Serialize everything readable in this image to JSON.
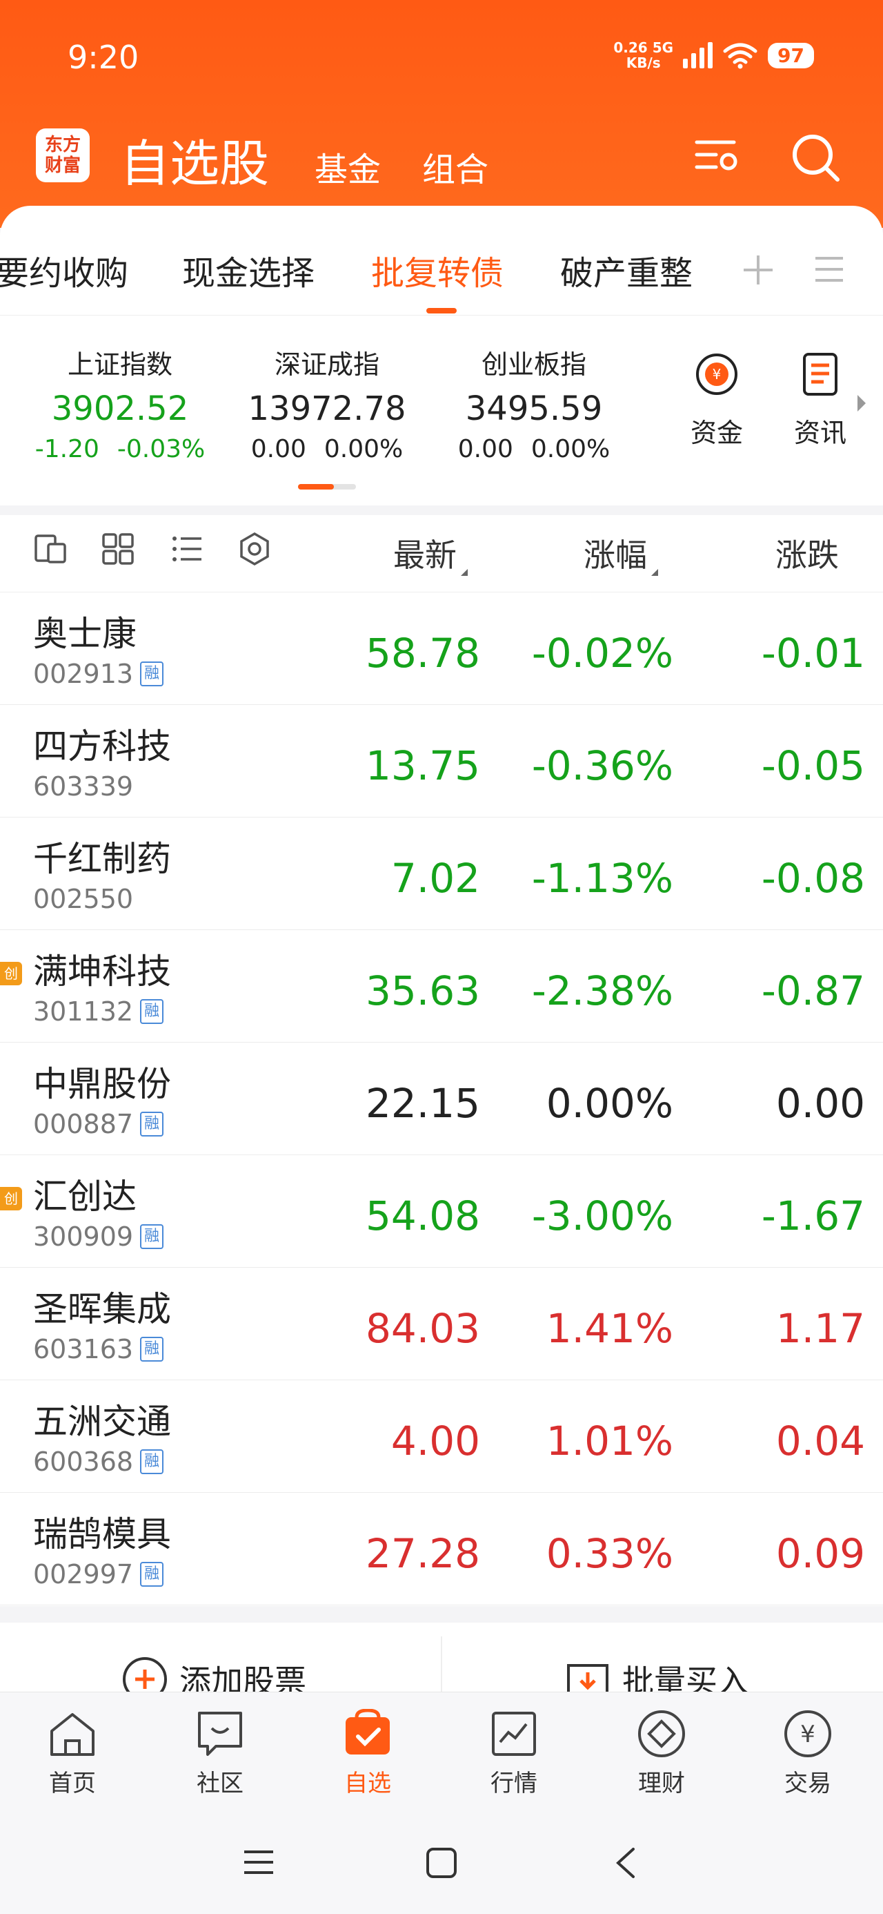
{
  "status_bar": {
    "time": "9:20",
    "net_speed_value": "0.26",
    "net_speed_unit": "KB/s",
    "network": "5G",
    "battery": "97"
  },
  "header": {
    "logo_line1": "东方",
    "logo_line2": "财富",
    "title": "自选股",
    "tabs": [
      "基金",
      "组合"
    ],
    "icons": [
      "settings-list-icon",
      "search-icon"
    ],
    "accent_color": "#ff5a14"
  },
  "group_tabs": {
    "items": [
      "要约收购",
      "现金选择",
      "批复转债",
      "破产重整"
    ],
    "active": "批复转债"
  },
  "indices": [
    {
      "name": "上证指数",
      "value": "3902.52",
      "change": "-1.20",
      "pct": "-0.03%",
      "trend": "down"
    },
    {
      "name": "深证成指",
      "value": "13972.78",
      "change": "0.00",
      "pct": "0.00%",
      "trend": "flat"
    },
    {
      "name": "创业板指",
      "value": "3495.59",
      "change": "0.00",
      "pct": "0.00%",
      "trend": "flat"
    }
  ],
  "quick_links": [
    {
      "label": "资金",
      "icon": "fund-flow-icon"
    },
    {
      "label": "资讯",
      "icon": "news-icon"
    }
  ],
  "columns": {
    "latest": "最新",
    "pct": "涨幅",
    "change": "涨跌"
  },
  "stocks": [
    {
      "name": "奥士康",
      "code": "002913",
      "rong": true,
      "chuang": false,
      "latest": "58.78",
      "pct": "-0.02%",
      "change": "-0.01",
      "trend": "green"
    },
    {
      "name": "四方科技",
      "code": "603339",
      "rong": false,
      "chuang": false,
      "latest": "13.75",
      "pct": "-0.36%",
      "change": "-0.05",
      "trend": "green"
    },
    {
      "name": "千红制药",
      "code": "002550",
      "rong": false,
      "chuang": false,
      "latest": "7.02",
      "pct": "-1.13%",
      "change": "-0.08",
      "trend": "green"
    },
    {
      "name": "满坤科技",
      "code": "301132",
      "rong": true,
      "chuang": true,
      "latest": "35.63",
      "pct": "-2.38%",
      "change": "-0.87",
      "trend": "green"
    },
    {
      "name": "中鼎股份",
      "code": "000887",
      "rong": true,
      "chuang": false,
      "latest": "22.15",
      "pct": "0.00%",
      "change": "0.00",
      "trend": "black"
    },
    {
      "name": "汇创达",
      "code": "300909",
      "rong": true,
      "chuang": true,
      "latest": "54.08",
      "pct": "-3.00%",
      "change": "-1.67",
      "trend": "green"
    },
    {
      "name": "圣晖集成",
      "code": "603163",
      "rong": true,
      "chuang": false,
      "latest": "84.03",
      "pct": "1.41%",
      "change": "1.17",
      "trend": "red"
    },
    {
      "name": "五洲交通",
      "code": "600368",
      "rong": true,
      "chuang": false,
      "latest": "4.00",
      "pct": "1.01%",
      "change": "0.04",
      "trend": "red"
    },
    {
      "name": "瑞鹄模具",
      "code": "002997",
      "rong": true,
      "chuang": false,
      "latest": "27.28",
      "pct": "0.33%",
      "change": "0.09",
      "trend": "red"
    }
  ],
  "badges": {
    "rong": "融",
    "chuang": "创"
  },
  "actions": {
    "add": "添加股票",
    "batch_buy": "批量买入"
  },
  "bottom_nav": [
    {
      "label": "首页",
      "icon": "home-icon"
    },
    {
      "label": "社区",
      "icon": "chat-icon"
    },
    {
      "label": "自选",
      "icon": "watchlist-icon",
      "active": true
    },
    {
      "label": "行情",
      "icon": "market-chart-icon"
    },
    {
      "label": "理财",
      "icon": "wealth-icon"
    },
    {
      "label": "交易",
      "icon": "trade-yuan-icon"
    }
  ],
  "colors": {
    "up": "#d92f2f",
    "down": "#15a21b",
    "flat": "#222222"
  }
}
